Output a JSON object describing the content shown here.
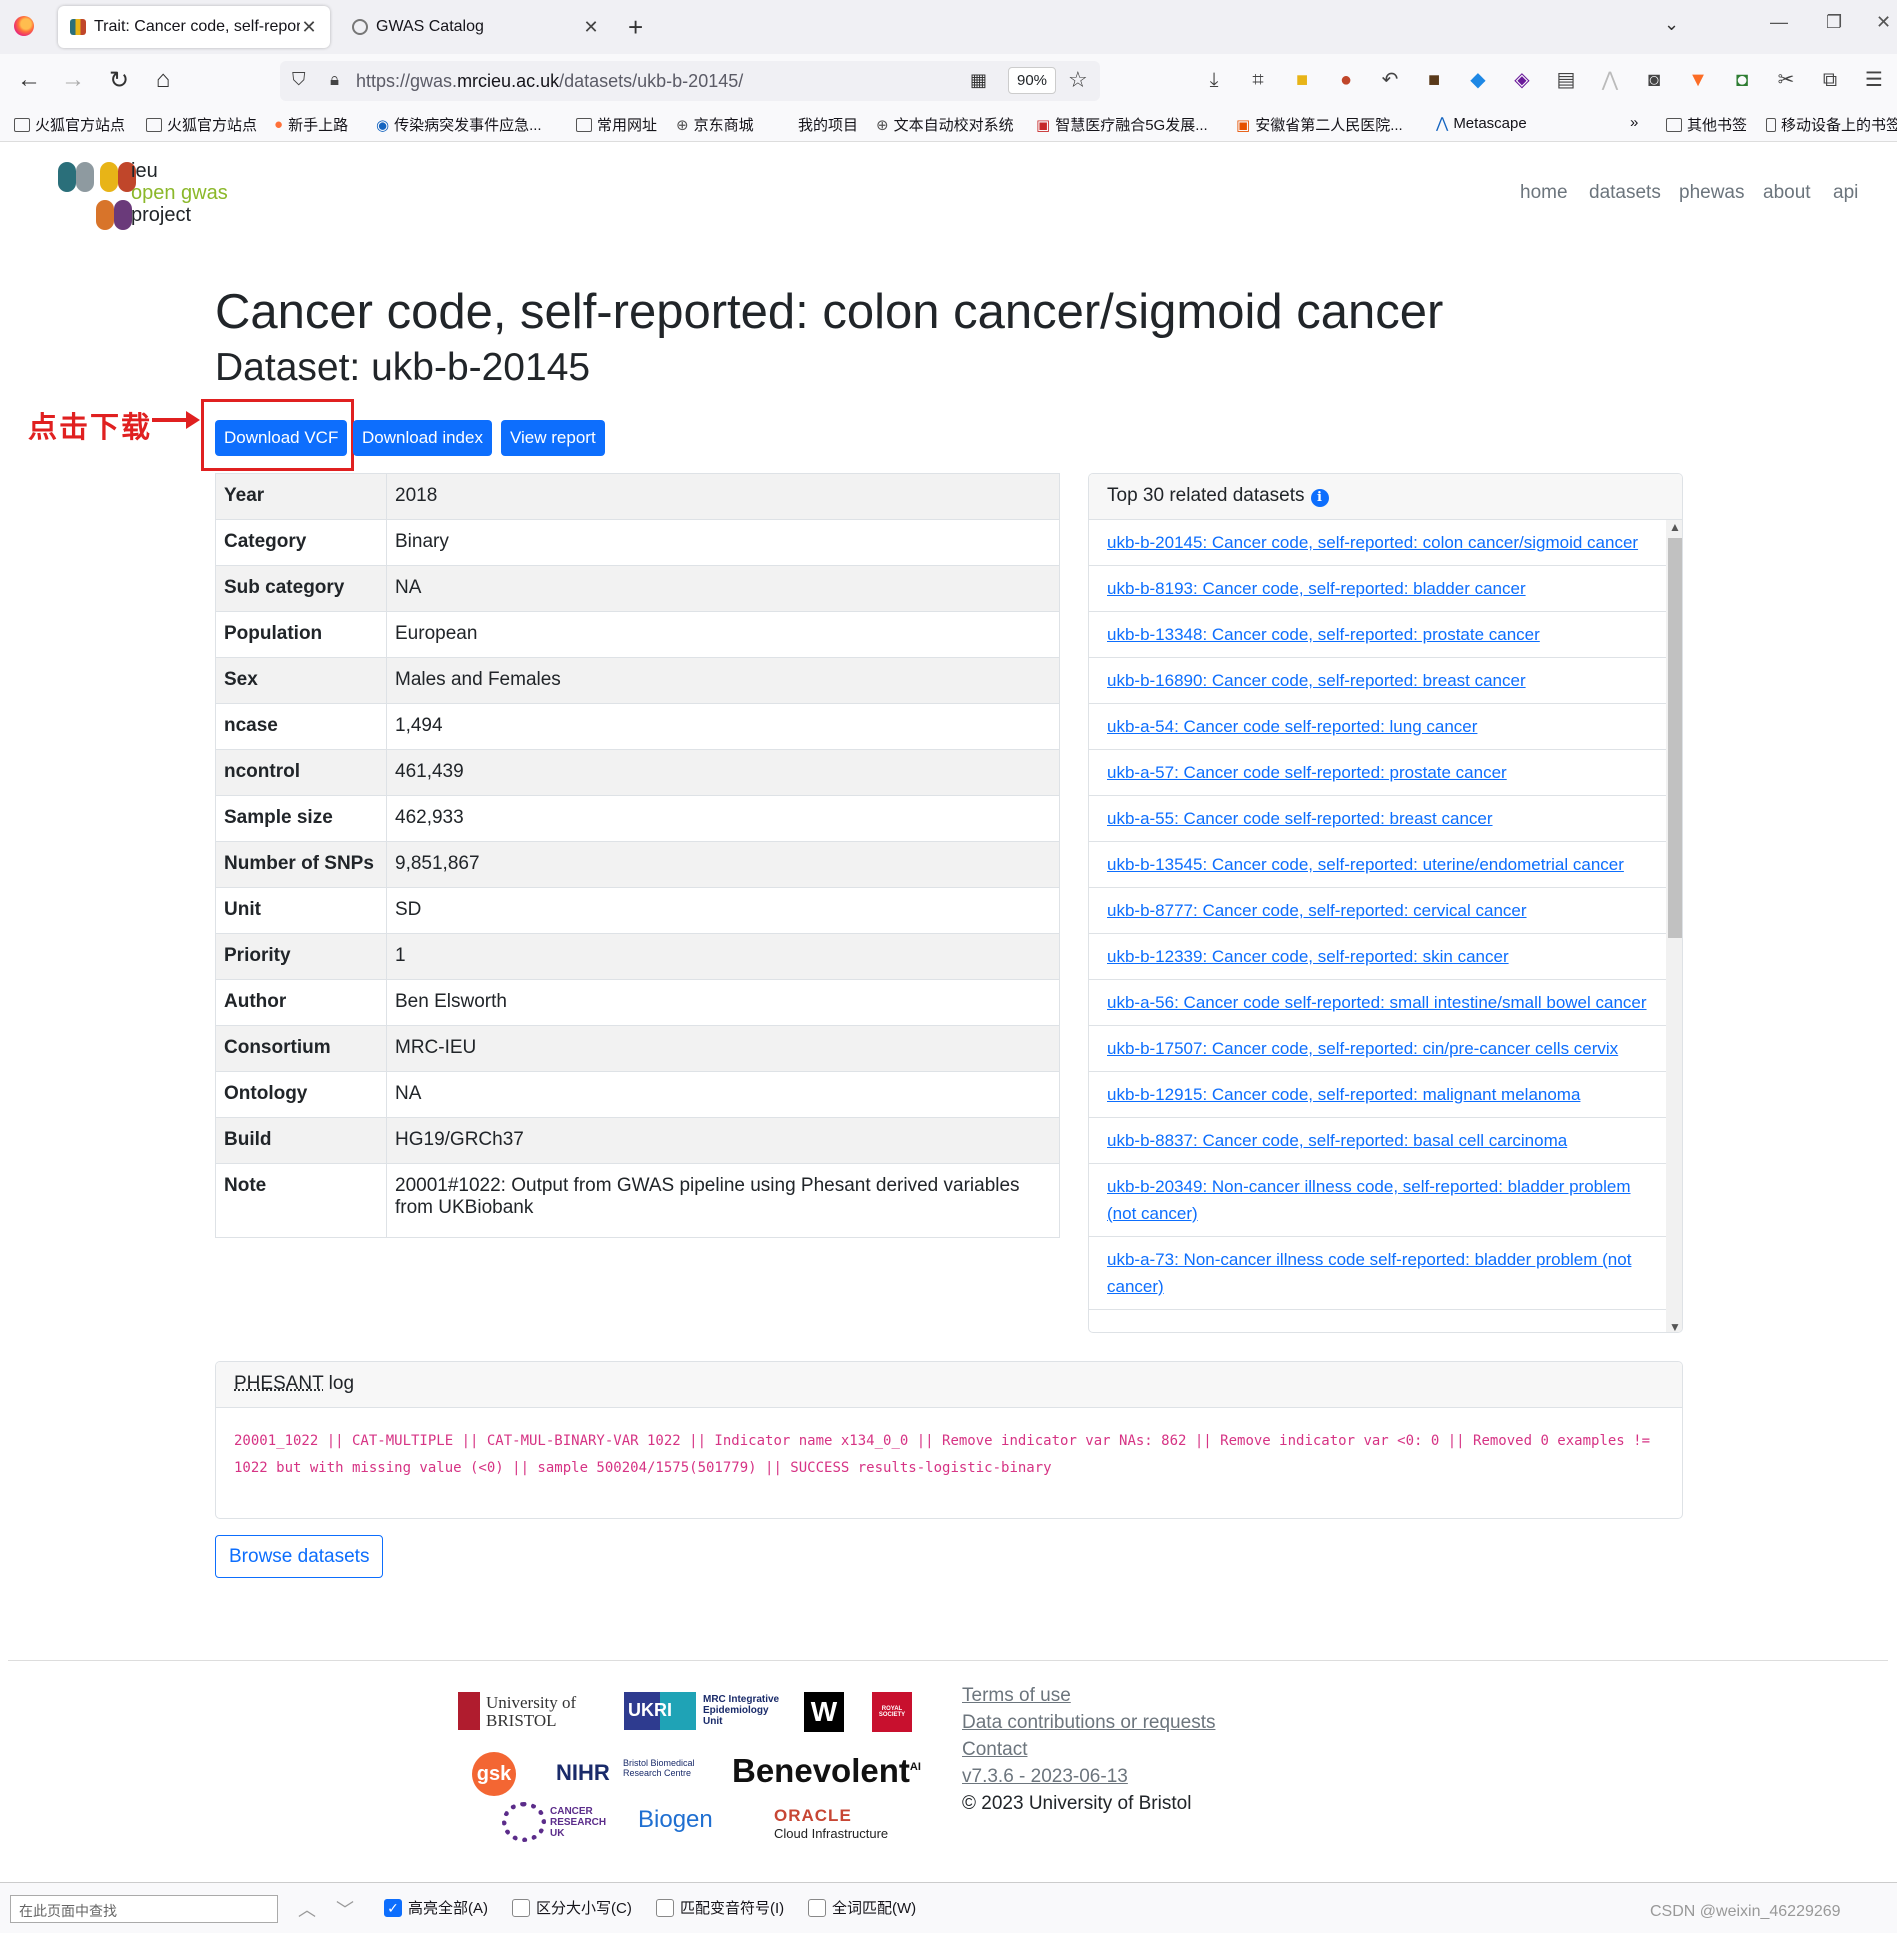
{
  "browser": {
    "tabs": [
      {
        "title": "Trait: Cancer code, self-repor",
        "active": true
      },
      {
        "title": "GWAS Catalog",
        "active": false
      }
    ],
    "url_prefix": "https://gwas.",
    "url_domain": "mrcieu.ac.uk",
    "url_path": "/datasets/ukb-b-20145/",
    "zoom": "90%",
    "bookmarks": [
      "火狐官方站点",
      "火狐官方站点",
      "新手上路",
      "传染病突发事件应急...",
      "常用网址",
      "京东商城",
      "我的项目",
      "文本自动校对系统",
      "智慧医疗融合5G发展...",
      "安徽省第二人民医院...",
      "Metascape",
      "其他书签",
      "移动设备上的书签"
    ]
  },
  "site": {
    "logo": {
      "line1": "ieu",
      "line2": "open gwas",
      "line3": "project"
    },
    "nav": [
      "home",
      "datasets",
      "phewas",
      "about",
      "api"
    ]
  },
  "trait_title": "Cancer code, self-reported: colon cancer/sigmoid cancer",
  "dataset_title": "Dataset: ukb-b-20145",
  "annotation": "点击下载",
  "buttons": {
    "download_vcf": "Download VCF",
    "download_index": "Download index",
    "view_report": "View report"
  },
  "metadata": [
    {
      "key": "Year",
      "value": "2018"
    },
    {
      "key": "Category",
      "value": "Binary"
    },
    {
      "key": "Sub category",
      "value": "NA"
    },
    {
      "key": "Population",
      "value": "European"
    },
    {
      "key": "Sex",
      "value": "Males and Females"
    },
    {
      "key": "ncase",
      "value": "1,494"
    },
    {
      "key": "ncontrol",
      "value": "461,439"
    },
    {
      "key": "Sample size",
      "value": "462,933"
    },
    {
      "key": "Number of SNPs",
      "value": "9,851,867"
    },
    {
      "key": "Unit",
      "value": "SD"
    },
    {
      "key": "Priority",
      "value": "1"
    },
    {
      "key": "Author",
      "value": "Ben Elsworth"
    },
    {
      "key": "Consortium",
      "value": "MRC-IEU"
    },
    {
      "key": "Ontology",
      "value": "NA"
    },
    {
      "key": "Build",
      "value": "HG19/GRCh37"
    },
    {
      "key": "Note",
      "value": "20001#1022: Output from GWAS pipeline using Phesant derived variables from UKBiobank"
    }
  ],
  "related": {
    "header": "Top 30 related datasets",
    "items": [
      "ukb-b-20145: Cancer code, self-reported: colon cancer/sigmoid cancer",
      "ukb-b-8193: Cancer code, self-reported: bladder cancer",
      "ukb-b-13348: Cancer code, self-reported: prostate cancer",
      "ukb-b-16890: Cancer code, self-reported: breast cancer",
      "ukb-a-54: Cancer code self-reported: lung cancer",
      "ukb-a-57: Cancer code self-reported: prostate cancer",
      "ukb-a-55: Cancer code self-reported: breast cancer",
      "ukb-b-13545: Cancer code, self-reported: uterine/endometrial cancer",
      "ukb-b-8777: Cancer code, self-reported: cervical cancer",
      "ukb-b-12339: Cancer code, self-reported: skin cancer",
      "ukb-a-56: Cancer code self-reported: small intestine/small bowel cancer",
      "ukb-b-17507: Cancer code, self-reported: cin/pre-cancer cells cervix",
      "ukb-b-12915: Cancer code, self-reported: malignant melanoma",
      "ukb-b-8837: Cancer code, self-reported: basal cell carcinoma",
      "ukb-b-20349: Non-cancer illness code, self-reported: bladder problem (not cancer)",
      "ukb-a-73: Non-cancer illness code self-reported: bladder problem (not cancer)"
    ]
  },
  "phesant": {
    "header_abbr": "PHESANT",
    "header_rest": " log",
    "log": "20001_1022 || CAT-MULTIPLE || CAT-MUL-BINARY-VAR 1022 || Indicator name x134_0_0 || Remove indicator var NAs: 862 || Remove indicator var <0: 0 || Removed 0 examples != 1022 but with missing value (<0) || sample 500204/1575(501779) || SUCCESS results-logistic-binary"
  },
  "browse_button": "Browse datasets",
  "footer": {
    "sponsors": {
      "bristol": "University of BRISTOL",
      "ukri": "UKRI",
      "mrc": "MRC Integrative Epidemiology Unit",
      "wellcome": "W",
      "royal": "ROYAL SOCIETY",
      "gsk": "gsk",
      "nihr": "NIHR",
      "nihr_sub": "Bristol Biomedical Research Centre",
      "benevolent": "Benevolent",
      "benevolent_sup": "AI",
      "cruk": "CANCER RESEARCH UK",
      "biogen": "Biogen",
      "oracle": "ORACLE",
      "oracle_sub": "Cloud Infrastructure"
    },
    "links": [
      "Terms of use",
      "Data contributions or requests",
      "Contact",
      "v7.3.6 - 2023-06-13"
    ],
    "copyright": "© 2023 University of Bristol"
  },
  "findbar": {
    "placeholder": "在此页面中查找",
    "options": [
      {
        "label": "高亮全部(A)",
        "checked": true
      },
      {
        "label": "区分大小写(C)",
        "checked": false
      },
      {
        "label": "匹配变音符号(I)",
        "checked": false
      },
      {
        "label": "全词匹配(W)",
        "checked": false
      }
    ],
    "watermark": "CSDN @weixin_46229269"
  }
}
